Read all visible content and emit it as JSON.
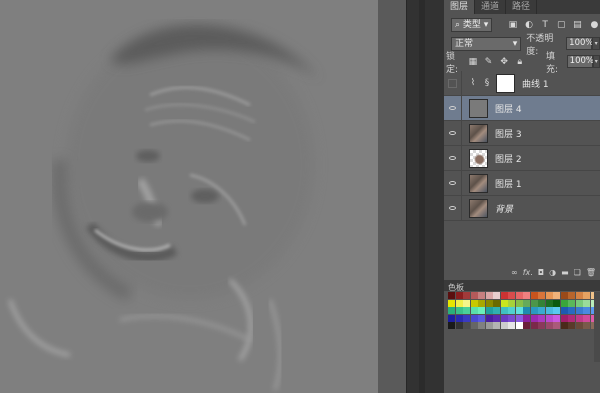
{
  "layers_panel": {
    "tabs": [
      "图层",
      "通道",
      "路径"
    ],
    "filter": {
      "label": "类型"
    },
    "blend_mode": "正常",
    "opacity": {
      "label": "不透明度:",
      "value": "100%"
    },
    "lock": {
      "label": "锁定:"
    },
    "fill": {
      "label": "填充:",
      "value": "100%"
    },
    "layers": [
      {
        "name": "曲线 1",
        "type": "adjustment",
        "visible": false,
        "selected": false
      },
      {
        "name": "图层 4",
        "type": "gray",
        "visible": true,
        "selected": true
      },
      {
        "name": "图层 3",
        "type": "photo",
        "visible": true,
        "selected": false
      },
      {
        "name": "图层 2",
        "type": "checker",
        "visible": true,
        "selected": false
      },
      {
        "name": "图层 1",
        "type": "photo",
        "visible": true,
        "selected": false
      },
      {
        "name": "背景",
        "type": "photo",
        "visible": true,
        "selected": false
      }
    ],
    "bottom_icons": [
      "link-icon",
      "fx-icon",
      "mask-icon",
      "adjustment-icon",
      "folder-icon",
      "new-layer-icon",
      "trash-icon"
    ]
  },
  "swatches_panel": {
    "title": "色板",
    "colors": [
      "#5a0f0f",
      "#8a1e1e",
      "#a23a3a",
      "#b55a5a",
      "#c78080",
      "#d9a6a6",
      "#e8cfcf",
      "#cc3333",
      "#d94c4c",
      "#e66666",
      "#f08080",
      "#c8541e",
      "#d8743a",
      "#e69656",
      "#f0b27a",
      "#9a4a1a",
      "#b8652c",
      "#d48244",
      "#e6a262",
      "#f0c28a",
      "#e6e600",
      "#f0f04a",
      "#f5f58a",
      "#c8c800",
      "#a8a800",
      "#888800",
      "#6a6a00",
      "#c8e61e",
      "#a6d23a",
      "#86be4a",
      "#66aa5a",
      "#4c964a",
      "#348236",
      "#1e6e22",
      "#0a5a10",
      "#3aa63a",
      "#5ab85a",
      "#7aca7a",
      "#9adc9a",
      "#baeeba",
      "#2ab07a",
      "#3ac08a",
      "#4ad09a",
      "#5ae0aa",
      "#6af0ba",
      "#20a0a0",
      "#30b0b0",
      "#40c0c0",
      "#50d0d0",
      "#60e0e0",
      "#1e8ab0",
      "#2a9ac0",
      "#3aaad0",
      "#4abae0",
      "#5acaf0",
      "#1e5ab0",
      "#2a6ac0",
      "#3a7ad0",
      "#4a8ae0",
      "#5a9af0",
      "#1e1ea0",
      "#2a2ab0",
      "#3a3ac0",
      "#4a4ad0",
      "#5a5ae0",
      "#4a1ea0",
      "#5a2ab0",
      "#6a3ac0",
      "#7a4ad0",
      "#8a5ae0",
      "#8a1ea0",
      "#9a2ab0",
      "#aa3ac0",
      "#ba4ad0",
      "#ca5ae0",
      "#a01e6a",
      "#b02a7a",
      "#c03a8a",
      "#d04a9a",
      "#e05aaa",
      "#1a1a1a",
      "#333333",
      "#4d4d4d",
      "#666666",
      "#808080",
      "#999999",
      "#b3b3b3",
      "#cccccc",
      "#e6e6e6",
      "#ffffff",
      "#6a1e3a",
      "#7a2a4a",
      "#8a3a5a",
      "#9a4a6a",
      "#aa5a7a",
      "#4a2a1a",
      "#5a3a2a",
      "#6a4a3a",
      "#7a5a4a",
      "#8a6a5a"
    ]
  }
}
